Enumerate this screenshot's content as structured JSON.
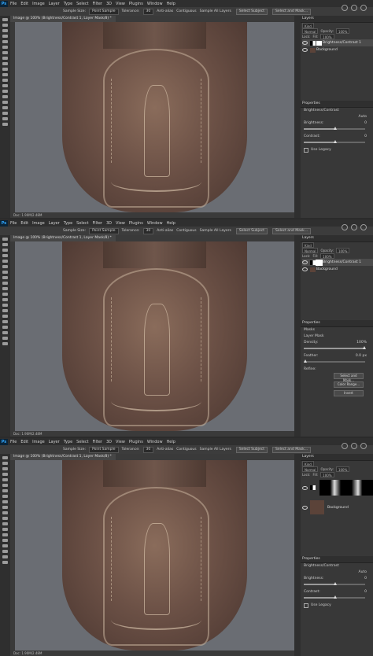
{
  "menu": [
    "File",
    "Edit",
    "Image",
    "Layer",
    "Type",
    "Select",
    "Filter",
    "3D",
    "View",
    "Plugins",
    "Window",
    "Help"
  ],
  "options": {
    "sample_size_label": "Sample Size:",
    "sample_size_value": "Point Sample",
    "tolerance_label": "Tolerance:",
    "tolerance_value": "30",
    "anti_alias": "Anti-alias",
    "contiguous": "Contiguous",
    "sample_all": "Sample All Layers",
    "select_subject": "Select Subject",
    "select_mask": "Select and Mask..."
  },
  "document": {
    "tab_title": "Image @ 100% (Brightness/Contrast 1, Layer Mask/8) *",
    "status": "Doc: 1.90M/2.48M"
  },
  "layers_panel": {
    "title": "Layers",
    "kind": "Kind",
    "blend": "Normal",
    "opacity_label": "Opacity:",
    "opacity": "100%",
    "lock_label": "Lock:",
    "fill_label": "Fill:",
    "fill": "100%",
    "layers": [
      "Brightness/Contrast 1",
      "Background"
    ]
  },
  "properties": {
    "title": "Properties",
    "bc_title": "Brightness/Contrast",
    "auto": "Auto",
    "brightness_label": "Brightness:",
    "brightness": "0",
    "contrast_label": "Contrast:",
    "contrast": "0",
    "use_legacy": "Use Legacy",
    "masks_title": "Masks",
    "layer_mask": "Layer Mask",
    "density_label": "Density:",
    "density": "100%",
    "feather_label": "Feather:",
    "feather": "0.0 px",
    "refine_label": "Refine:",
    "select_mask_btn": "Select and Mask...",
    "color_range_btn": "Color Range...",
    "invert_btn": "Invert"
  }
}
